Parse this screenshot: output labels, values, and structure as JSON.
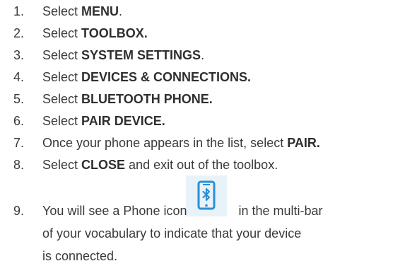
{
  "steps": [
    {
      "num": "1.",
      "prefix": "Select ",
      "bold": "MENU",
      "suffix": "."
    },
    {
      "num": "2.",
      "prefix": "Select ",
      "bold": "TOOLBOX.",
      "suffix": ""
    },
    {
      "num": "3.",
      "prefix": "Select ",
      "bold": "SYSTEM SETTINGS",
      "suffix": "."
    },
    {
      "num": "4.",
      "prefix": "Select ",
      "bold": "DEVICES & CONNECTIONS.",
      "suffix": ""
    },
    {
      "num": "5.",
      "prefix": "Select ",
      "bold": "BLUETOOTH PHONE.",
      "suffix": ""
    },
    {
      "num": "6.",
      "prefix": "Select ",
      "bold": "PAIR DEVICE.",
      "suffix": ""
    },
    {
      "num": "7.",
      "prefix": "Once your phone appears in the list, select ",
      "bold": "PAIR.",
      "suffix": ""
    },
    {
      "num": "8.",
      "prefix": "Select ",
      "bold": "CLOSE",
      "suffix": " and exit out of the toolbox."
    }
  ],
  "step9": {
    "num": "9.",
    "line1_prefix": "You will see a Phone icon",
    "line1_suffix": "in the multi-bar",
    "line2": "of your vocabulary to indicate that your device",
    "line3": "is connected."
  },
  "icons": {
    "phone_icon": "bluetooth-phone-icon"
  },
  "colors": {
    "icon_blue": "#2b8fd6",
    "icon_bg": "#e8f2f9",
    "text": "#3a3a3a"
  }
}
